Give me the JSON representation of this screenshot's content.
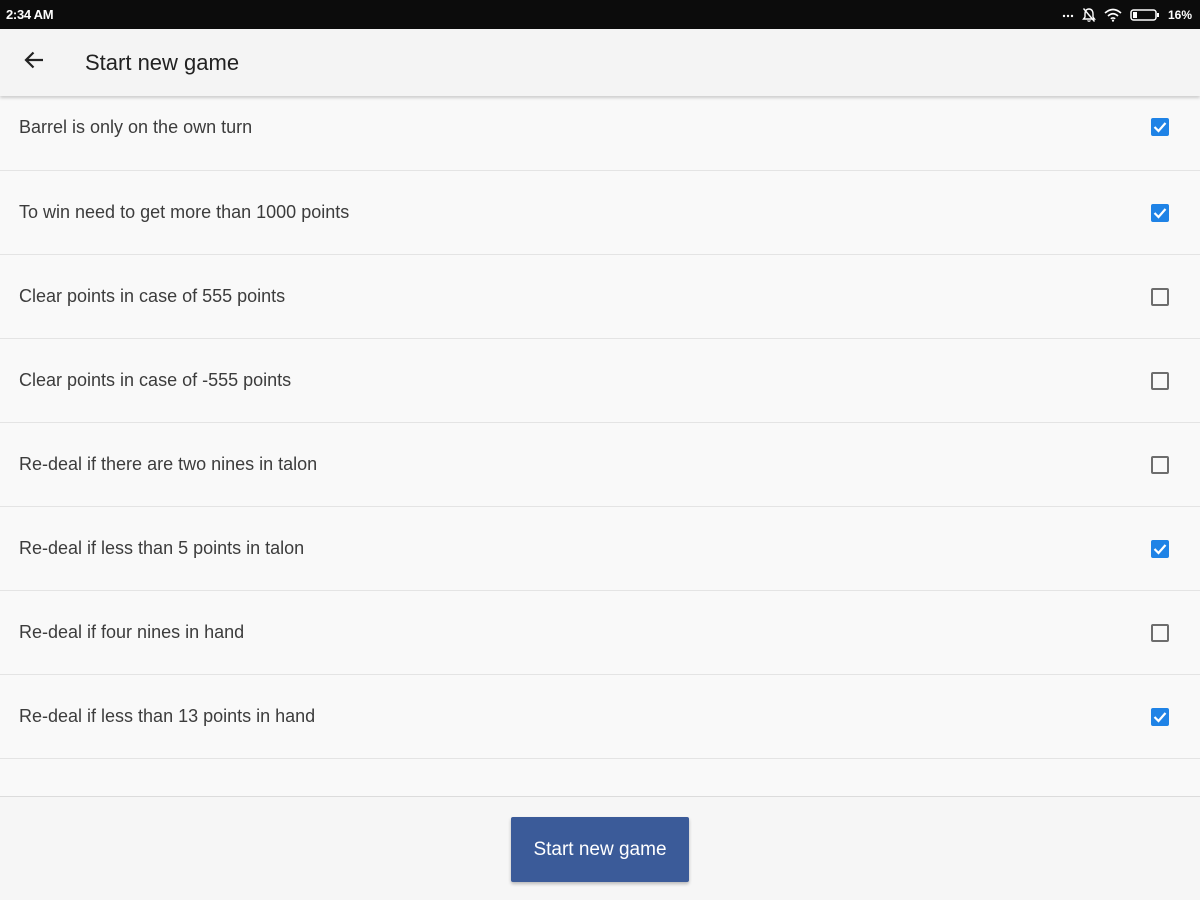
{
  "status_bar": {
    "time": "2:34 AM",
    "battery": "16%",
    "icons": [
      "more-dots-icon",
      "silent-bell-icon",
      "wifi-icon",
      "battery-icon"
    ]
  },
  "app_bar": {
    "back_icon": "arrow-back-icon",
    "title": "Start new game"
  },
  "settings": [
    {
      "label": "Barrel is only on the own turn",
      "checked": true
    },
    {
      "label": "To win need to get more than 1000 points",
      "checked": true
    },
    {
      "label": "Clear points in case of 555 points",
      "checked": false
    },
    {
      "label": "Clear points in case of -555 points",
      "checked": false
    },
    {
      "label": "Re-deal if there are two nines in talon",
      "checked": false
    },
    {
      "label": "Re-deal if less than 5 points in talon",
      "checked": true
    },
    {
      "label": "Re-deal if four nines in hand",
      "checked": false
    },
    {
      "label": "Re-deal if less than 13 points in hand",
      "checked": true
    }
  ],
  "footer": {
    "start_button_label": "Start new game"
  },
  "colors": {
    "accent": "#1f83e6",
    "button": "#3b5b99",
    "status_bar": "#0c0c0c"
  }
}
